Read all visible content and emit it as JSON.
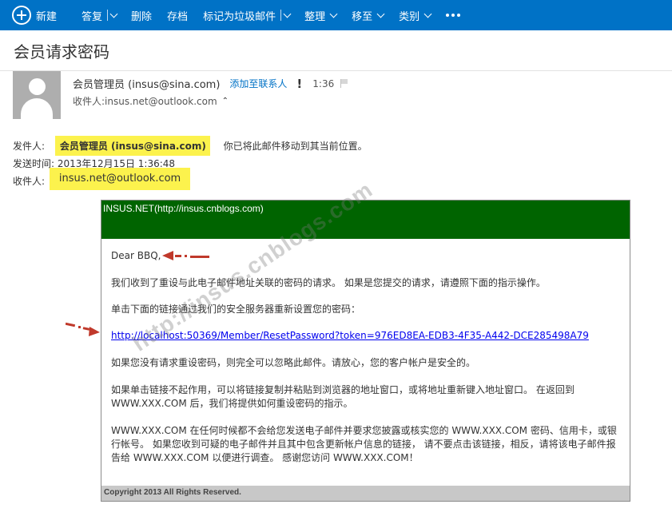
{
  "toolbar": {
    "new_label": "新建",
    "reply_label": "答复",
    "delete_label": "删除",
    "archive_label": "存档",
    "junk_label": "标记为垃圾邮件",
    "sweep_label": "整理",
    "move_label": "移至",
    "categories_label": "类别",
    "more_label": "•••",
    "bar_color": "#0072c6"
  },
  "message": {
    "subject": "会员请求密码",
    "sender": "会员管理员 (insus@sina.com)",
    "add_contact": "添加至联系人",
    "importance": "!",
    "time": "1:36",
    "recipient_line": "收件人:insus.net@outlook.com",
    "collapse_icon": "double-chevron-up"
  },
  "forward_info": {
    "from_label": "发件人:",
    "from_value": "会员管理员 (insus@sina.com)",
    "moved_note": "你已将此邮件移动到其当前位置。",
    "sent_label": "发送时间:",
    "sent_value": "2013年12月15日 1:36:48",
    "to_label": "收件人:",
    "to_value": "insus.net@outlook.com",
    "highlight_color": "#fcf24d"
  },
  "email_card": {
    "header": "INSUS.NET(http://insus.cnblogs.com)",
    "header_color": "#006400",
    "greeting": "Dear BBQ,",
    "line1": "我们收到了重设与此电子邮件地址关联的密码的请求。 如果是您提交的请求，请遵照下面的指示操作。",
    "line2": "单击下面的链接通过我们的安全服务器重新设置您的密码：",
    "reset_link": "http://localhost:50369/Member/ResetPassword?token=976ED8EA-EDB3-4F35-A442-DCE285498A79",
    "line3": "如果您没有请求重设密码，则完全可以忽略此邮件。请放心，您的客户帐户是安全的。",
    "line4a": "如果单击链接不起作用，可以将链接复制并粘贴到浏览器的地址窗口，或将地址重新键入地址窗口。 在返回到",
    "line4b": "WWW.XXX.COM 后，我们将提供如何重设密码的指示。",
    "line5a": "WWW.XXX.COM 在任何时候都不会给您发送电子邮件并要求您披露或核实您的 WWW.XXX.COM 密码、信用卡，或银",
    "line5b": "行帐号。 如果您收到可疑的电子邮件并且其中包含更新帐户信息的链接， 请不要点击该链接，相反，请将该电子邮件报",
    "line5c": "告给 WWW.XXX.COM 以便进行调查。 感谢您访问 WWW.XXX.COM！",
    "footer": "Copyright 2013 All Rights Reserved.",
    "footer_color": "#c8c8c8"
  },
  "watermark": "http://insus.cnblogs.com",
  "annotation_color": "#c0392b"
}
